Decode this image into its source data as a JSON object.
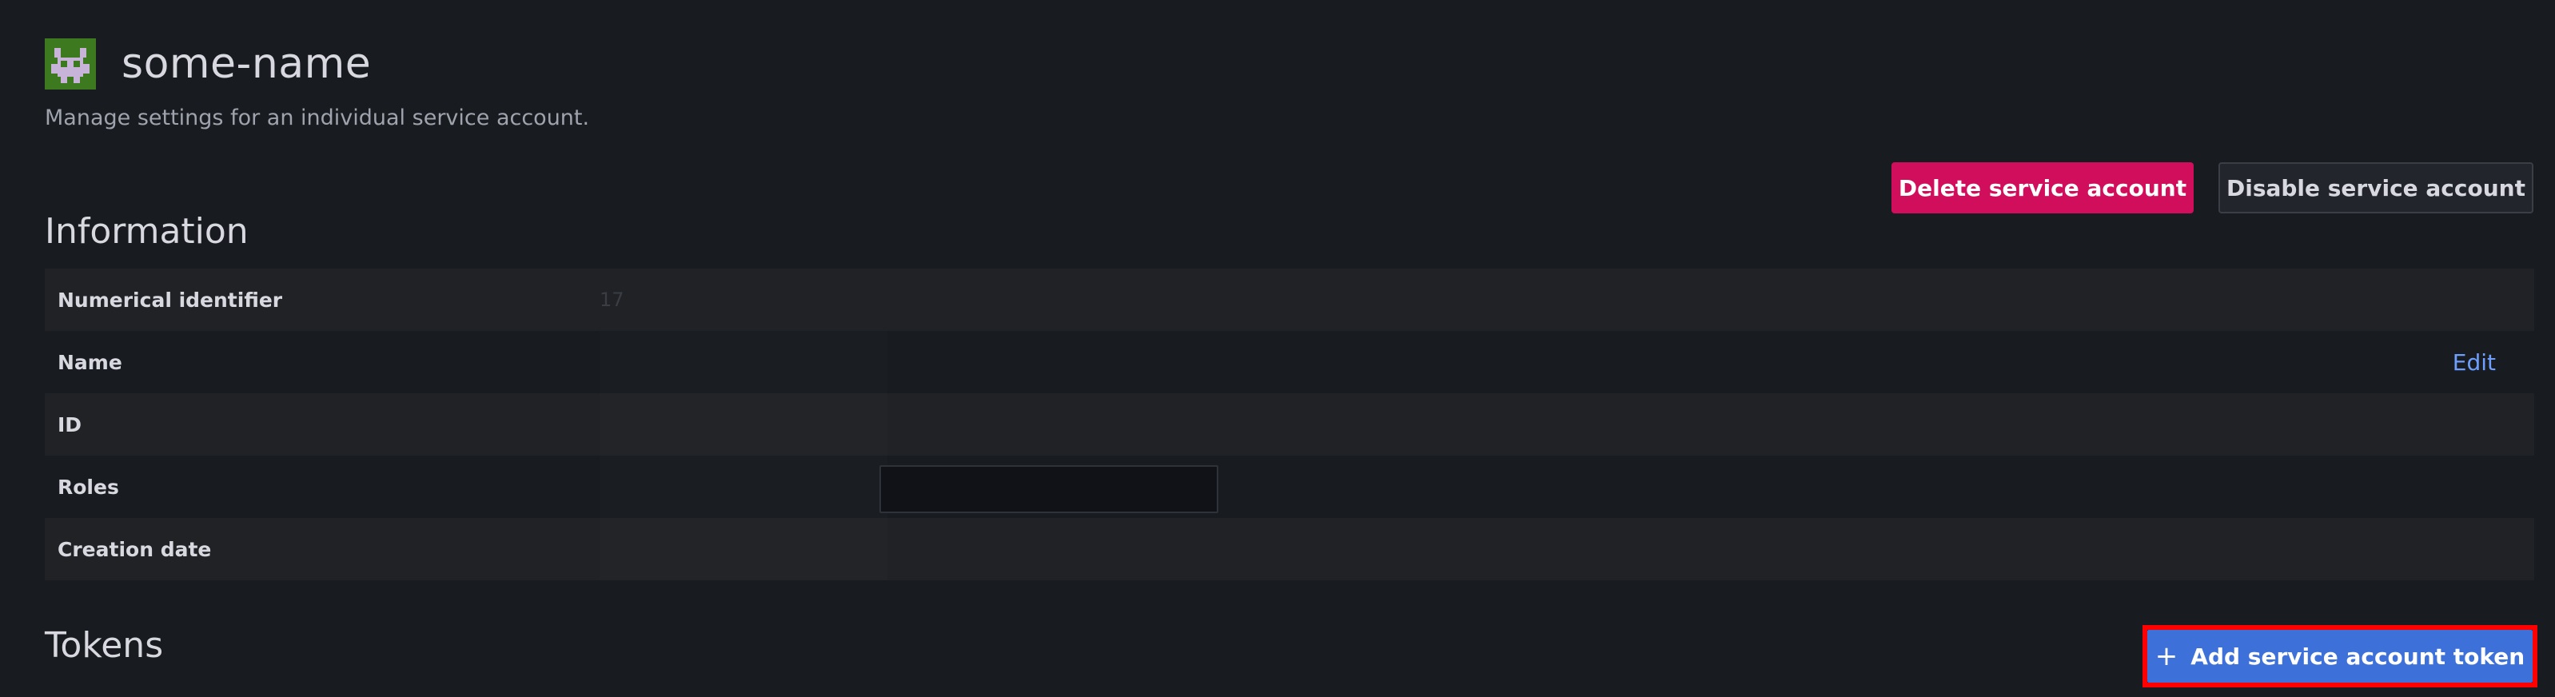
{
  "header": {
    "title": "some-name",
    "subtitle": "Manage settings for an individual service account.",
    "avatar_icon": "service-account-avatar-icon"
  },
  "actions": {
    "delete_label": "Delete service account",
    "disable_label": "Disable service account"
  },
  "information": {
    "heading": "Information",
    "rows": [
      {
        "label": "Numerical identifier",
        "value": "17"
      },
      {
        "label": "Name",
        "value": "",
        "action": "Edit"
      },
      {
        "label": "ID",
        "value": ""
      },
      {
        "label": "Roles",
        "value": ""
      },
      {
        "label": "Creation date",
        "value": ""
      }
    ]
  },
  "tokens": {
    "heading": "Tokens",
    "add_label": "Add service account token",
    "add_icon": "plus-icon"
  },
  "colors": {
    "delete_button": "#d10e5c",
    "primary_button": "#3d71d9",
    "highlight": "#ff0000",
    "link": "#6e9fff"
  }
}
